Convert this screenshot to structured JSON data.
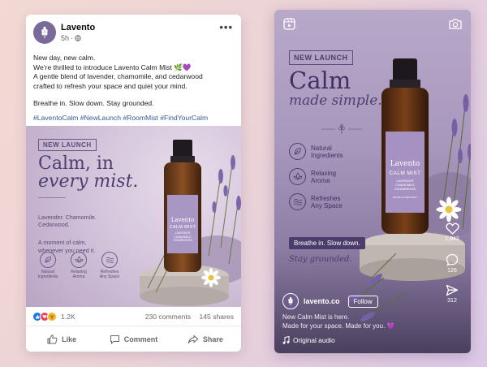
{
  "fb_post": {
    "page_name": "Lavento",
    "time": "5h",
    "body": {
      "line1": "New day, new calm.",
      "line2": "We’re thrilled to introduce Lavento Calm Mist 🌿💜",
      "line3": "A gentle blend of lavender, chamomile, and cedarwood\ncrafted to refresh your space and quiet your mind.",
      "line4": "Breathe in. Slow down. Stay grounded."
    },
    "hashtags": "#LaventoCalm #NewLaunch #RoomMist #FindYourCalm",
    "creative": {
      "badge": "NEW LAUNCH",
      "headline_1": "Calm, in",
      "headline_2": "every mist.",
      "notes": "Lavender. Chamomile.\nCedarwood.",
      "tagline": "A moment of calm,\nwhenever you need it.",
      "features": [
        {
          "label": "Natural\nIngredients",
          "icon": "leaf-icon"
        },
        {
          "label": "Relaxing\nAroma",
          "icon": "lotus-icon"
        },
        {
          "label": "Refreshes\nAny Space",
          "icon": "waves-icon"
        }
      ],
      "bottle": {
        "brand": "Lavento",
        "product": "CALM MIST",
        "notes": "LAVENDER\nCHAMOMILE\nCEDARWOOD"
      }
    },
    "reactions_count": "1.2K",
    "comments": "230 comments",
    "shares": "145 shares",
    "actions": {
      "like": "Like",
      "comment": "Comment",
      "share": "Share"
    }
  },
  "reel": {
    "badge": "NEW LAUNCH",
    "headline_1": "Calm",
    "headline_2": "made simple.",
    "features": [
      {
        "label": "Natural\nIngredients",
        "icon": "leaf-icon"
      },
      {
        "label": "Relaxing\nAroma",
        "icon": "lotus-icon"
      },
      {
        "label": "Refreshes\nAny Space",
        "icon": "waves-icon"
      }
    ],
    "pill": "Breathe in. Slow down.",
    "subline": "Stay grounded.",
    "bottle": {
      "brand": "Lavento",
      "product": "CALM MIST",
      "notes": "LAVENDER\nCHAMOMILE\nCEDARWOOD",
      "footer": "ROOM & LINEN MIST"
    },
    "likes": "1,842",
    "comments": "126",
    "shares": "312",
    "username": "lavento.co",
    "follow": "Follow",
    "caption": "New Calm Mist is here.\nMade for your space. Made for you. 💜",
    "audio": "Original audio"
  },
  "colors": {
    "brand_purple": "#4c3f6e",
    "fb_link": "#385898",
    "like_blue": "#1877f2",
    "love_red": "#f33e58"
  }
}
